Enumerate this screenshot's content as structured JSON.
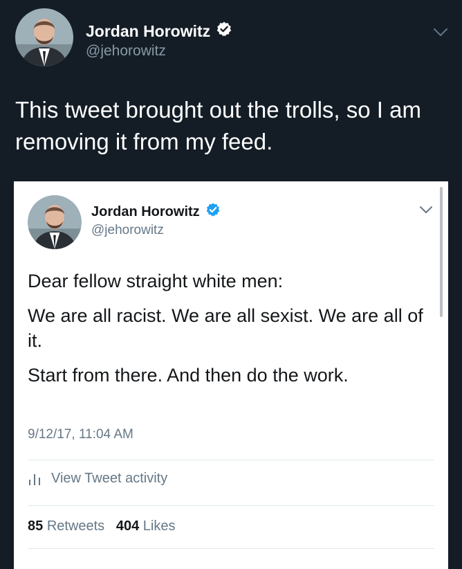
{
  "outer_tweet": {
    "author_name": "Jordan Horowitz",
    "handle": "@jehorowitz",
    "text": "This tweet brought out the trolls, so I am removing it from my feed."
  },
  "quoted_tweet": {
    "author_name": "Jordan Horowitz",
    "handle": "@jehorowitz",
    "paragraphs": [
      "Dear fellow straight white men:",
      "We are all racist. We are all sexist. We are all of it.",
      "Start from there. And then do the work."
    ],
    "timestamp": "9/12/17, 11:04 AM",
    "activity_label": "View Tweet activity",
    "retweets_count": "85",
    "retweets_label": "Retweets",
    "likes_count": "404",
    "likes_label": "Likes"
  },
  "icons": {
    "verified": "verified-badge-icon",
    "chevron": "chevron-down-icon",
    "activity": "bar-chart-icon"
  },
  "colors": {
    "outer_background": "#141d26",
    "card_background": "#ffffff",
    "verified_blue": "#1da1f2",
    "secondary_text_dark": "#8899a6",
    "secondary_text_light": "#657786"
  }
}
